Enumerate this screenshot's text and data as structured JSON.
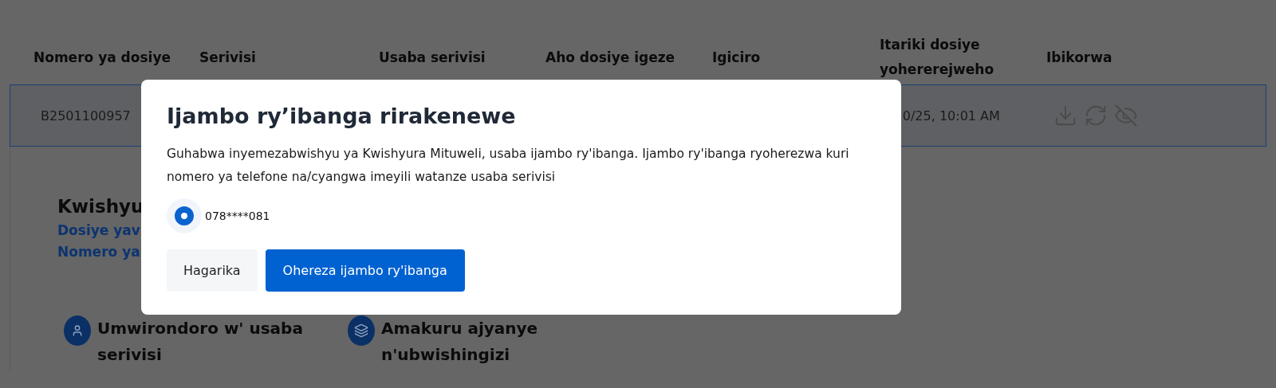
{
  "table": {
    "columns": [
      "Nomero ya dosiye",
      "Serivisi",
      "Usaba serivisi",
      "Aho dosiye igeze",
      "Igiciro",
      "Itariki dosiye yohererejweho",
      "Ibikorwa"
    ],
    "row": {
      "file_number": "B2501100957",
      "date": "0/25, 10:01 AM",
      "selected": true
    }
  },
  "details": {
    "title": "Kwishyu",
    "links": [
      "Dosiye yav",
      "Nomero ya"
    ],
    "cards": [
      {
        "kind": "person",
        "title": "Umwirondoro w' usaba serivisi"
      },
      {
        "kind": "layers",
        "title": "Amakuru ajyanye n'ubwishingizi"
      }
    ]
  },
  "modal": {
    "title": "Ijambo ry’ibanga rirakenewe",
    "message": "Guhabwa inyemezabwishyu ya Kwishyura Mituweli, usaba ijambo ry'ibanga. Ijambo ry'ibanga ryoherezwa kuri nomero ya telefone na/cyangwa imeyili watanze usaba serivisi",
    "options": [
      {
        "label": "078****081",
        "selected": true
      }
    ],
    "buttons": [
      {
        "kind": "secondary",
        "label": "Hagarika"
      },
      {
        "kind": "primary",
        "label": "Ohereza ijambo ry'ibanga"
      }
    ]
  }
}
